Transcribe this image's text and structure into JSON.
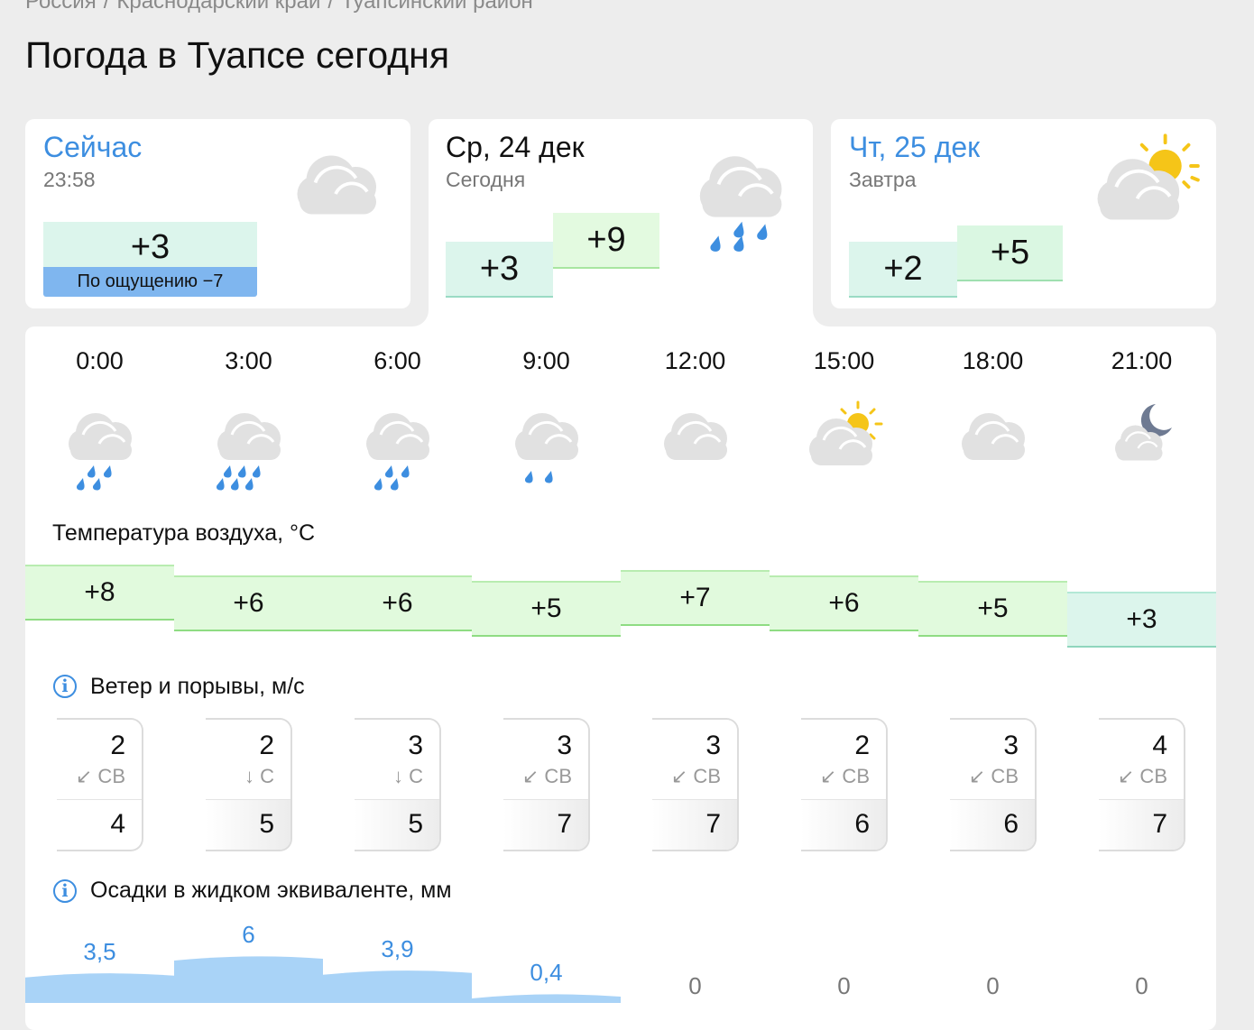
{
  "breadcrumb": [
    "Россия",
    "Краснодарский край",
    "Туапсинский район"
  ],
  "page_title": "Погода в Туапсе сегодня",
  "now_card": {
    "title": "Сейчас",
    "time": "23:58",
    "temp": "+3",
    "feels": "По ощущению −7",
    "icon": "cloudy-icon"
  },
  "today_card": {
    "title": "Ср, 24 дек",
    "sub": "Сегодня",
    "temp_min": "+3",
    "temp_max": "+9",
    "icon": "rain-cloud-icon"
  },
  "tomorrow_card": {
    "title": "Чт, 25 дек",
    "sub": "Завтра",
    "temp_min": "+2",
    "temp_max": "+5",
    "icon": "partly-sunny-icon"
  },
  "hours": [
    {
      "time": "0:00",
      "icon": "rain-icon",
      "temp": "+8",
      "wind": "2",
      "dir": "↙ СВ",
      "gust": "4",
      "prec": "3,5",
      "prec_value": 3.5
    },
    {
      "time": "3:00",
      "icon": "heavy-rain-icon",
      "temp": "+6",
      "wind": "2",
      "dir": "↓ С",
      "gust": "5",
      "prec": "6",
      "prec_value": 6
    },
    {
      "time": "6:00",
      "icon": "rain-icon",
      "temp": "+6",
      "wind": "3",
      "dir": "↓ С",
      "gust": "5",
      "prec": "3,9",
      "prec_value": 3.9
    },
    {
      "time": "9:00",
      "icon": "light-rain-icon",
      "temp": "+5",
      "wind": "3",
      "dir": "↙ СВ",
      "gust": "7",
      "prec": "0,4",
      "prec_value": 0.4
    },
    {
      "time": "12:00",
      "icon": "cloudy-icon",
      "temp": "+7",
      "wind": "3",
      "dir": "↙ СВ",
      "gust": "7",
      "prec": "0",
      "prec_value": 0
    },
    {
      "time": "15:00",
      "icon": "partly-sunny-icon",
      "temp": "+6",
      "wind": "2",
      "dir": "↙ СВ",
      "gust": "6",
      "prec": "0",
      "prec_value": 0
    },
    {
      "time": "18:00",
      "icon": "cloudy-icon",
      "temp": "+5",
      "wind": "3",
      "dir": "↙ СВ",
      "gust": "6",
      "prec": "0",
      "prec_value": 0
    },
    {
      "time": "21:00",
      "icon": "moon-cloud-icon",
      "temp": "+3",
      "wind": "4",
      "dir": "↙ СВ",
      "gust": "7",
      "prec": "0",
      "prec_value": 0
    }
  ],
  "sections": {
    "temperature": "Температура воздуха, °C",
    "wind": "Ветер и порывы, м/с",
    "precipitation": "Осадки в жидком эквиваленте, мм"
  },
  "colors": {
    "accent": "#3d8ee0",
    "rain": "#3d8ee0",
    "sun": "#f5c518",
    "cloud": "#e0e0e0"
  }
}
